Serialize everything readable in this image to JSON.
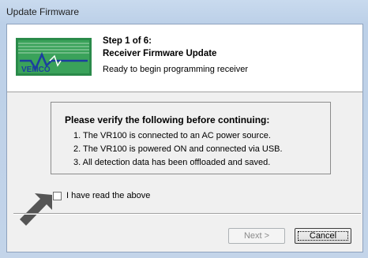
{
  "window": {
    "title": "Update Firmware"
  },
  "header": {
    "logo_text": "VEMCO",
    "step": "Step 1 of 6:",
    "subtitle": "Receiver Firmware Update",
    "description": "Ready to begin programming receiver"
  },
  "verify": {
    "title": "Please verify the following before continuing:",
    "items": [
      "1. The VR100 is connected to an AC power source.",
      "2. The VR100 is powered ON and connected via USB.",
      "3. All detection data has been offloaded and saved."
    ]
  },
  "checkbox": {
    "label": "I have read the above",
    "checked": false
  },
  "buttons": {
    "next": "Next >",
    "cancel": "Cancel"
  },
  "colors": {
    "logo_green": "#2a8a4a",
    "logo_blue": "#1b3f9e",
    "arrow": "#555555"
  }
}
